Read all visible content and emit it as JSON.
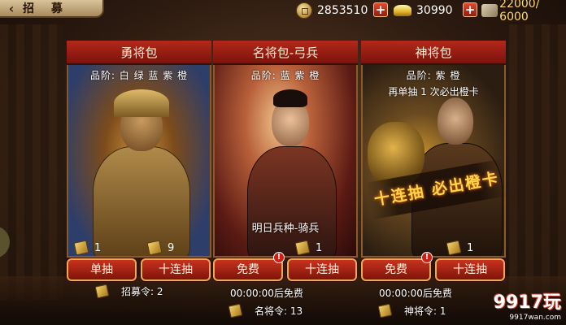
{
  "header": {
    "title": "招 募",
    "back_icon": "back-arrow-icon"
  },
  "resources": {
    "coins": "2853510",
    "gold": "30990",
    "capacity": "22000/ 6000"
  },
  "cards": [
    {
      "title": "勇将包",
      "grade": "品阶: 白 绿 蓝 紫 橙",
      "counts": [
        "1",
        "9"
      ],
      "buttons": [
        "单抽",
        "十连抽"
      ],
      "info": "招募令: 2"
    },
    {
      "title": "名将包-弓兵",
      "grade": "品阶: 蓝 紫 橙",
      "tomorrow": "明日兵种-骑兵",
      "counts": [
        "1"
      ],
      "buttons": [
        "免费",
        "十连抽"
      ],
      "free_timer": "00:00:00后免费",
      "info": "名将令: 13"
    },
    {
      "title": "神将包",
      "grade": "品阶: 紫 橙",
      "grade_note": "再单抽 1 次必出橙卡",
      "banner": "十连抽 必出橙卡",
      "counts": [
        "1"
      ],
      "buttons": [
        "免费",
        "十连抽"
      ],
      "free_timer": "00:00:00后免费",
      "info": "神将令: 1"
    }
  ],
  "watermark": {
    "logo": "9917玩",
    "url": "9917wan.com"
  },
  "colors": {
    "title_red": "#b4281b",
    "button_red": "#c8321e",
    "button_border": "#e7a95a",
    "gold_text": "#ffd96b"
  }
}
